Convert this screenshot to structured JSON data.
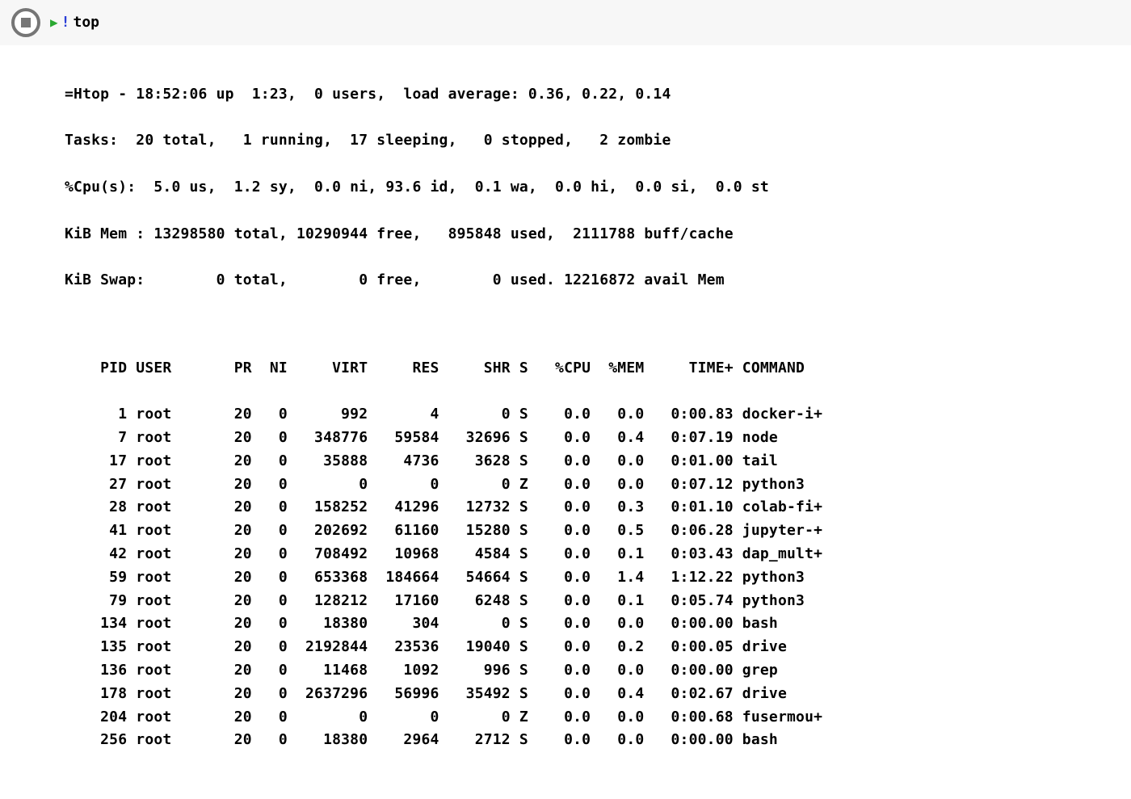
{
  "input": {
    "bang": "!",
    "command": "top"
  },
  "summary": {
    "line1": "=Htop - 18:52:06 up  1:23,  0 users,  load average: 0.36, 0.22, 0.14",
    "line2": "Tasks:  20 total,   1 running,  17 sleeping,   0 stopped,   2 zombie",
    "line3": "%Cpu(s):  5.0 us,  1.2 sy,  0.0 ni, 93.6 id,  0.1 wa,  0.0 hi,  0.0 si,  0.0 st",
    "line4": "KiB Mem : 13298580 total, 10290944 free,   895848 used,  2111788 buff/cache",
    "line5": "KiB Swap:        0 total,        0 free,        0 used. 12216872 avail Mem"
  },
  "columns": [
    "PID",
    "USER",
    "PR",
    "NI",
    "VIRT",
    "RES",
    "SHR",
    "S",
    "%CPU",
    "%MEM",
    "TIME+",
    "COMMAND"
  ],
  "processes": [
    {
      "pid": "1",
      "user": "root",
      "pr": "20",
      "ni": "0",
      "virt": "992",
      "res": "4",
      "shr": "0",
      "s": "S",
      "cpu": "0.0",
      "mem": "0.0",
      "time": "0:00.83",
      "command": "docker-i+"
    },
    {
      "pid": "7",
      "user": "root",
      "pr": "20",
      "ni": "0",
      "virt": "348776",
      "res": "59584",
      "shr": "32696",
      "s": "S",
      "cpu": "0.0",
      "mem": "0.4",
      "time": "0:07.19",
      "command": "node"
    },
    {
      "pid": "17",
      "user": "root",
      "pr": "20",
      "ni": "0",
      "virt": "35888",
      "res": "4736",
      "shr": "3628",
      "s": "S",
      "cpu": "0.0",
      "mem": "0.0",
      "time": "0:01.00",
      "command": "tail"
    },
    {
      "pid": "27",
      "user": "root",
      "pr": "20",
      "ni": "0",
      "virt": "0",
      "res": "0",
      "shr": "0",
      "s": "Z",
      "cpu": "0.0",
      "mem": "0.0",
      "time": "0:07.12",
      "command": "python3"
    },
    {
      "pid": "28",
      "user": "root",
      "pr": "20",
      "ni": "0",
      "virt": "158252",
      "res": "41296",
      "shr": "12732",
      "s": "S",
      "cpu": "0.0",
      "mem": "0.3",
      "time": "0:01.10",
      "command": "colab-fi+"
    },
    {
      "pid": "41",
      "user": "root",
      "pr": "20",
      "ni": "0",
      "virt": "202692",
      "res": "61160",
      "shr": "15280",
      "s": "S",
      "cpu": "0.0",
      "mem": "0.5",
      "time": "0:06.28",
      "command": "jupyter-+"
    },
    {
      "pid": "42",
      "user": "root",
      "pr": "20",
      "ni": "0",
      "virt": "708492",
      "res": "10968",
      "shr": "4584",
      "s": "S",
      "cpu": "0.0",
      "mem": "0.1",
      "time": "0:03.43",
      "command": "dap_mult+"
    },
    {
      "pid": "59",
      "user": "root",
      "pr": "20",
      "ni": "0",
      "virt": "653368",
      "res": "184664",
      "shr": "54664",
      "s": "S",
      "cpu": "0.0",
      "mem": "1.4",
      "time": "1:12.22",
      "command": "python3"
    },
    {
      "pid": "79",
      "user": "root",
      "pr": "20",
      "ni": "0",
      "virt": "128212",
      "res": "17160",
      "shr": "6248",
      "s": "S",
      "cpu": "0.0",
      "mem": "0.1",
      "time": "0:05.74",
      "command": "python3"
    },
    {
      "pid": "134",
      "user": "root",
      "pr": "20",
      "ni": "0",
      "virt": "18380",
      "res": "304",
      "shr": "0",
      "s": "S",
      "cpu": "0.0",
      "mem": "0.0",
      "time": "0:00.00",
      "command": "bash"
    },
    {
      "pid": "135",
      "user": "root",
      "pr": "20",
      "ni": "0",
      "virt": "2192844",
      "res": "23536",
      "shr": "19040",
      "s": "S",
      "cpu": "0.0",
      "mem": "0.2",
      "time": "0:00.05",
      "command": "drive"
    },
    {
      "pid": "136",
      "user": "root",
      "pr": "20",
      "ni": "0",
      "virt": "11468",
      "res": "1092",
      "shr": "996",
      "s": "S",
      "cpu": "0.0",
      "mem": "0.0",
      "time": "0:00.00",
      "command": "grep"
    },
    {
      "pid": "178",
      "user": "root",
      "pr": "20",
      "ni": "0",
      "virt": "2637296",
      "res": "56996",
      "shr": "35492",
      "s": "S",
      "cpu": "0.0",
      "mem": "0.4",
      "time": "0:02.67",
      "command": "drive"
    },
    {
      "pid": "204",
      "user": "root",
      "pr": "20",
      "ni": "0",
      "virt": "0",
      "res": "0",
      "shr": "0",
      "s": "Z",
      "cpu": "0.0",
      "mem": "0.0",
      "time": "0:00.68",
      "command": "fusermou+"
    },
    {
      "pid": "256",
      "user": "root",
      "pr": "20",
      "ni": "0",
      "virt": "18380",
      "res": "2964",
      "shr": "2712",
      "s": "S",
      "cpu": "0.0",
      "mem": "0.0",
      "time": "0:00.00",
      "command": "bash"
    }
  ]
}
